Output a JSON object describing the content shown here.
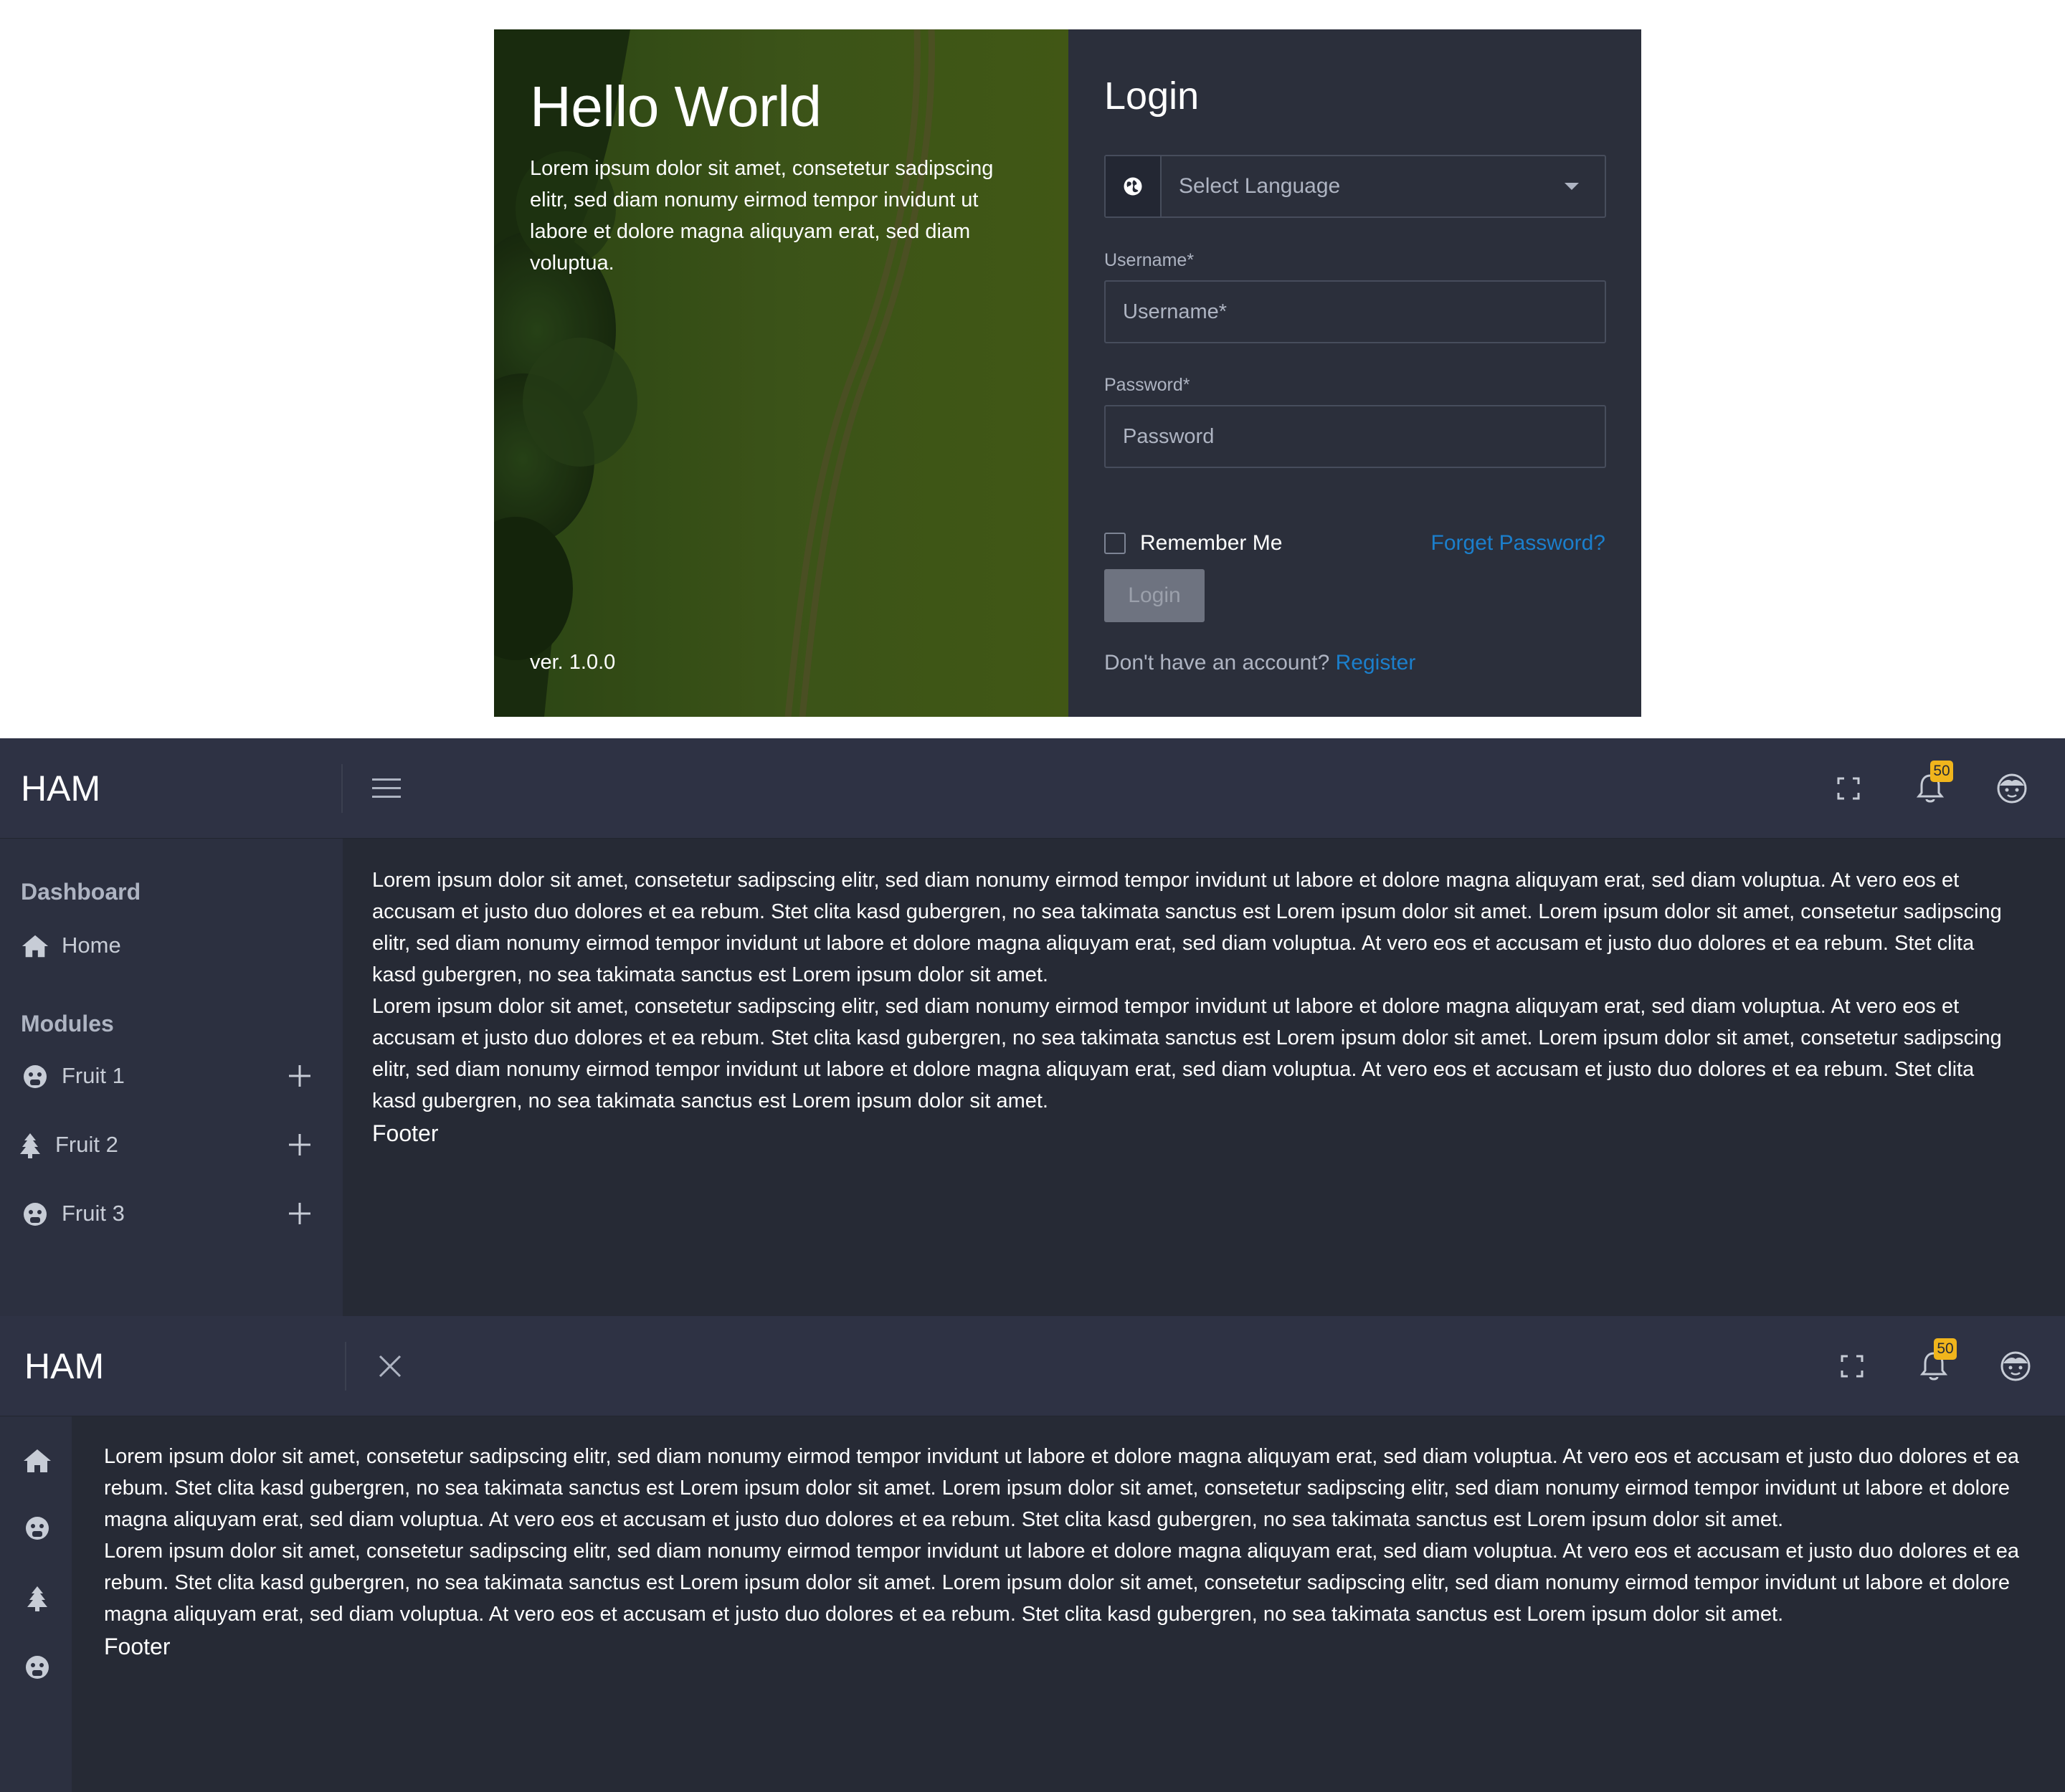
{
  "login": {
    "hero_title": "Hello World",
    "hero_text": "Lorem ipsum dolor sit amet, consetetur sadipscing elitr, sed diam nonumy eirmod tempor invidunt ut labore et dolore magna aliquyam erat, sed diam voluptua.",
    "version": "ver. 1.0.0",
    "title": "Login",
    "language_select": {
      "value": "Select Language",
      "icon": "globe-icon"
    },
    "username": {
      "label": "Username*",
      "placeholder": "Username*",
      "value": ""
    },
    "password": {
      "label": "Password*",
      "placeholder": "Password",
      "value": ""
    },
    "remember_me": {
      "label": "Remember Me",
      "checked": false
    },
    "forgot_password": "Forget Password?",
    "login_button": "Login",
    "register_prompt": "Don't have an account?",
    "register_link": "Register"
  },
  "dashboard_expanded": {
    "brand": "HAM",
    "menu_icon": "hamburger-icon",
    "notification_count": "50",
    "sidebar": {
      "dashboard_title": "Dashboard",
      "home": {
        "label": "Home",
        "icon": "home-icon"
      },
      "modules_title": "Modules",
      "items": [
        {
          "label": "Fruit 1",
          "icon": "face-icon"
        },
        {
          "label": "Fruit 2",
          "icon": "tree-icon"
        },
        {
          "label": "Fruit 3",
          "icon": "face-icon"
        }
      ]
    },
    "content": {
      "paragraph1": "Lorem ipsum dolor sit amet, consetetur sadipscing elitr, sed diam nonumy eirmod tempor invidunt ut labore et dolore magna aliquyam erat, sed diam voluptua. At vero eos et accusam et justo duo dolores et ea rebum. Stet clita kasd gubergren, no sea takimata sanctus est Lorem ipsum dolor sit amet. Lorem ipsum dolor sit amet, consetetur sadipscing elitr, sed diam nonumy eirmod tempor invidunt ut labore et dolore magna aliquyam erat, sed diam voluptua. At vero eos et accusam et justo duo dolores et ea rebum. Stet clita kasd gubergren, no sea takimata sanctus est Lorem ipsum dolor sit amet.",
      "paragraph2": "Lorem ipsum dolor sit amet, consetetur sadipscing elitr, sed diam nonumy eirmod tempor invidunt ut labore et dolore magna aliquyam erat, sed diam voluptua. At vero eos et accusam et justo duo dolores et ea rebum. Stet clita kasd gubergren, no sea takimata sanctus est Lorem ipsum dolor sit amet. Lorem ipsum dolor sit amet, consetetur sadipscing elitr, sed diam nonumy eirmod tempor invidunt ut labore et dolore magna aliquyam erat, sed diam voluptua. At vero eos et accusam et justo duo dolores et ea rebum. Stet clita kasd gubergren, no sea takimata sanctus est Lorem ipsum dolor sit amet.",
      "footer": "Footer"
    }
  },
  "dashboard_collapsed": {
    "brand": "HAM",
    "menu_icon": "close-icon",
    "notification_count": "50",
    "sidebar_icons": [
      "home-icon",
      "face-icon",
      "tree-icon",
      "face-icon"
    ],
    "content": {
      "paragraph1": "Lorem ipsum dolor sit amet, consetetur sadipscing elitr, sed diam nonumy eirmod tempor invidunt ut labore et dolore magna aliquyam erat, sed diam voluptua. At vero eos et accusam et justo duo dolores et ea rebum. Stet clita kasd gubergren, no sea takimata sanctus est Lorem ipsum dolor sit amet. Lorem ipsum dolor sit amet, consetetur sadipscing elitr, sed diam nonumy eirmod tempor invidunt ut labore et dolore magna aliquyam erat, sed diam voluptua. At vero eos et accusam et justo duo dolores et ea rebum. Stet clita kasd gubergren, no sea takimata sanctus est Lorem ipsum dolor sit amet.",
      "paragraph2": "Lorem ipsum dolor sit amet, consetetur sadipscing elitr, sed diam nonumy eirmod tempor invidunt ut labore et dolore magna aliquyam erat, sed diam voluptua. At vero eos et accusam et justo duo dolores et ea rebum. Stet clita kasd gubergren, no sea takimata sanctus est Lorem ipsum dolor sit amet. Lorem ipsum dolor sit amet, consetetur sadipscing elitr, sed diam nonumy eirmod tempor invidunt ut labore et dolore magna aliquyam erat, sed diam voluptua. At vero eos et accusam et justo duo dolores et ea rebum. Stet clita kasd gubergren, no sea takimata sanctus est Lorem ipsum dolor sit amet.",
      "footer": "Footer"
    }
  },
  "colors": {
    "link": "#1b7fcc",
    "panel": "#2b2f3b",
    "topbar": "#2e3244",
    "sidebar": "#2c3040",
    "content_bg": "#262a35",
    "badge": "#f0b51c"
  }
}
